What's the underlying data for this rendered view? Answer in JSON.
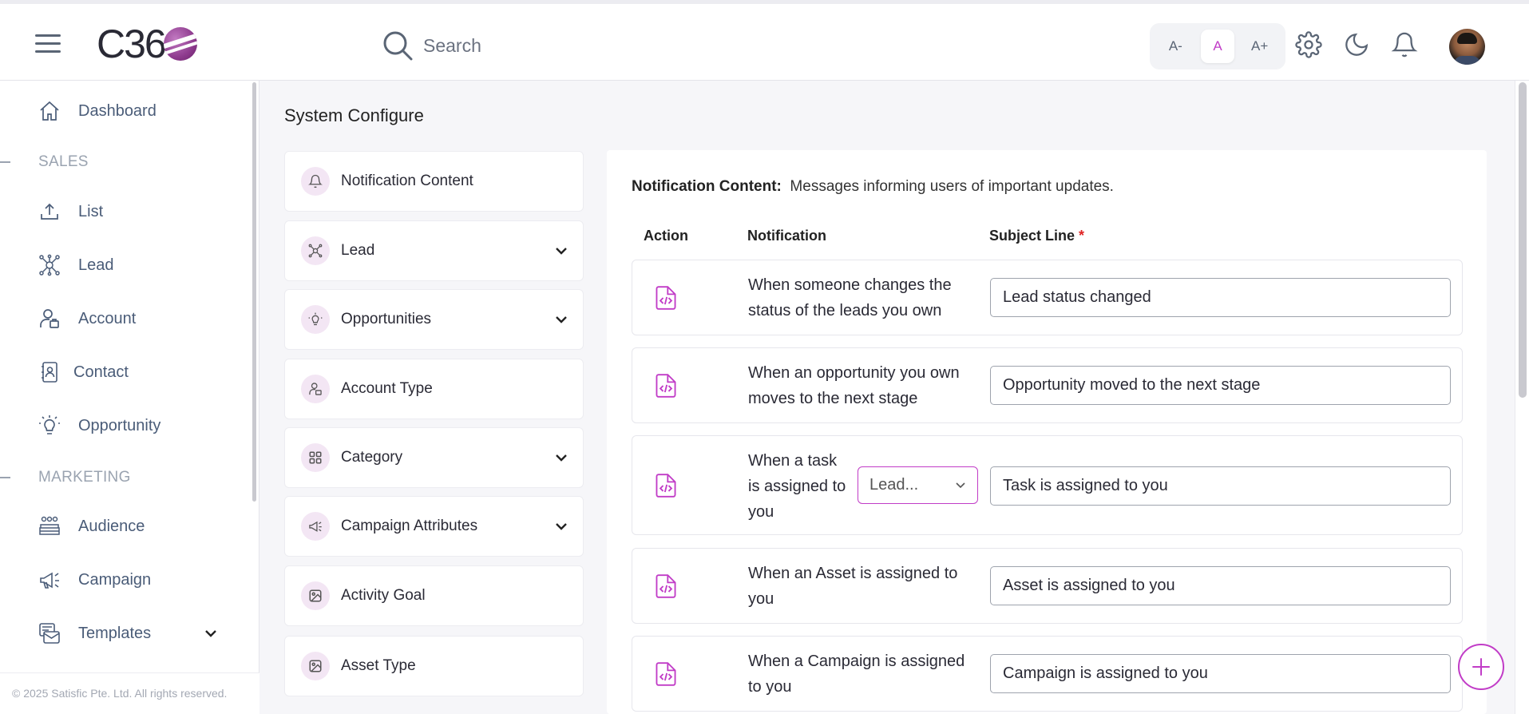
{
  "header": {
    "logo_text": "C36",
    "search_placeholder": "Search",
    "font_sizes": [
      "A-",
      "A",
      "A+"
    ]
  },
  "sidebar": {
    "items": [
      {
        "label": "Dashboard",
        "icon": "home-icon"
      },
      {
        "section": "SALES"
      },
      {
        "label": "List",
        "icon": "upload-icon"
      },
      {
        "label": "Lead",
        "icon": "network-icon"
      },
      {
        "label": "Account",
        "icon": "account-icon"
      },
      {
        "label": "Contact",
        "icon": "contact-icon"
      },
      {
        "label": "Opportunity",
        "icon": "bulb-icon"
      },
      {
        "section": "MARKETING"
      },
      {
        "label": "Audience",
        "icon": "audience-icon"
      },
      {
        "label": "Campaign",
        "icon": "megaphone-icon"
      },
      {
        "label": "Templates",
        "icon": "templates-icon"
      }
    ],
    "footer": "© 2025 Satisfic Pte. Ltd. All rights reserved."
  },
  "main": {
    "title": "System Configure",
    "menu": [
      {
        "label": "Notification Content",
        "icon": "bell-icon",
        "expandable": false
      },
      {
        "label": "Lead",
        "icon": "network-icon",
        "expandable": true
      },
      {
        "label": "Opportunities",
        "icon": "bulb-icon",
        "expandable": true
      },
      {
        "label": "Account Type",
        "icon": "account-icon",
        "expandable": false
      },
      {
        "label": "Category",
        "icon": "grid-icon",
        "expandable": true
      },
      {
        "label": "Campaign Attributes",
        "icon": "megaphone-icon",
        "expandable": true
      },
      {
        "label": "Activity Goal",
        "icon": "image-icon",
        "expandable": false
      },
      {
        "label": "Asset Type",
        "icon": "image-icon",
        "expandable": false
      }
    ],
    "notification": {
      "heading": "Notification Content:",
      "subheading": "Messages informing users of important updates.",
      "columns": {
        "action": "Action",
        "notification": "Notification",
        "subject": "Subject Line",
        "required_mark": "*"
      },
      "rows": [
        {
          "line1": "When someone changes the",
          "line2": "status of the leads you own",
          "subject": "Lead status changed"
        },
        {
          "line1": "When an opportunity you own",
          "line2": "moves to the next stage",
          "subject": "Opportunity moved to the next stage"
        },
        {
          "line1": "When a task",
          "line2": "is assigned to",
          "line3": "you",
          "select": "Lead...",
          "subject": "Task is assigned to you"
        },
        {
          "line1": "When an Asset is assigned to",
          "line2": "you",
          "subject": "Asset is assigned to you"
        },
        {
          "line1": "When a Campaign is assigned",
          "line2": "to you",
          "subject": "Campaign is assigned to you"
        }
      ]
    }
  },
  "colors": {
    "accent": "#c13cc7",
    "nav_text": "#4a5c78",
    "section_text": "#9aa3b0"
  }
}
